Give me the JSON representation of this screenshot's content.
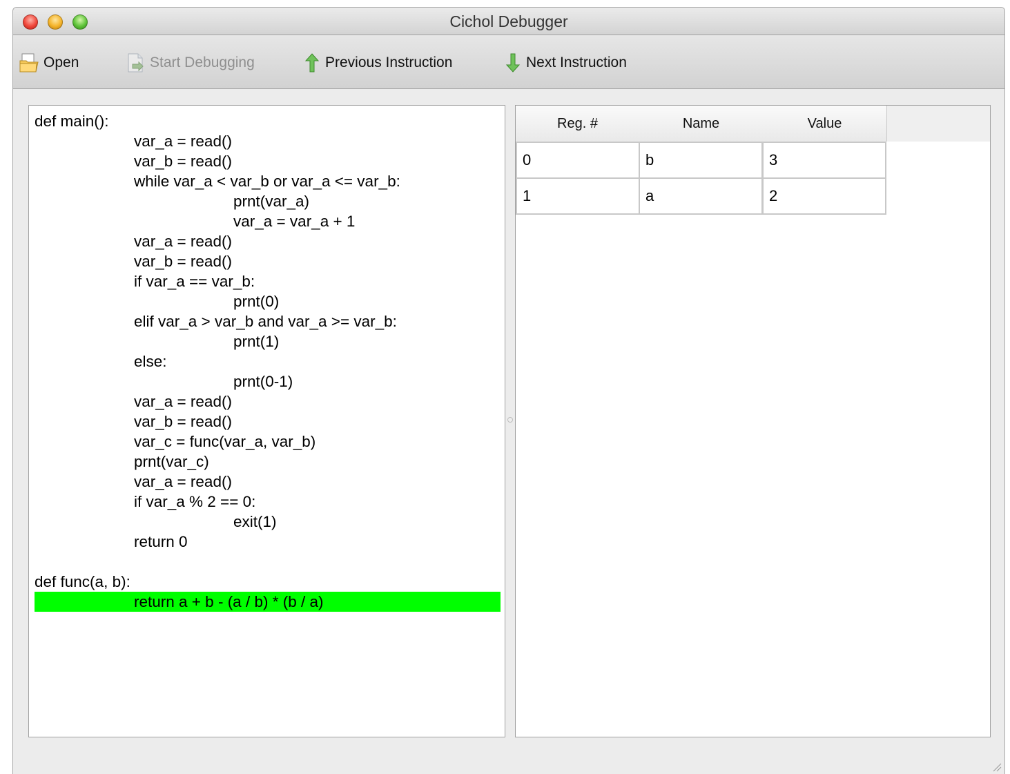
{
  "window": {
    "title": "Cichol Debugger"
  },
  "toolbar": {
    "open": "Open",
    "start": "Start Debugging",
    "prev": "Previous Instruction",
    "next": "Next Instruction"
  },
  "code": {
    "lines": [
      "def main():",
      "\t\tvar_a = read()",
      "\t\tvar_b = read()",
      "\t\twhile var_a < var_b or var_a <= var_b:",
      "\t\t\t\tprnt(var_a)",
      "\t\t\t\tvar_a = var_a + 1",
      "\t\tvar_a = read()",
      "\t\tvar_b = read()",
      "\t\tif var_a == var_b:",
      "\t\t\t\tprnt(0)",
      "\t\telif var_a > var_b and var_a >= var_b:",
      "\t\t\t\tprnt(1)",
      "\t\telse:",
      "\t\t\t\tprnt(0-1)",
      "\t\tvar_a = read()",
      "\t\tvar_b = read()",
      "\t\tvar_c = func(var_a, var_b)",
      "\t\tprnt(var_c)",
      "\t\tvar_a = read()",
      "\t\tif var_a % 2 == 0:",
      "\t\t\t\texit(1)",
      "\t\treturn 0",
      "",
      "def func(a, b):",
      "\t\treturn a + b - (a / b) * (b / a)"
    ],
    "current_line": 25,
    "highlight_color": "#00ff00"
  },
  "registers": {
    "columns": [
      "Reg. #",
      "Name",
      "Value"
    ],
    "rows": [
      [
        "0",
        "b",
        "3"
      ],
      [
        "1",
        "a",
        "2"
      ]
    ]
  }
}
